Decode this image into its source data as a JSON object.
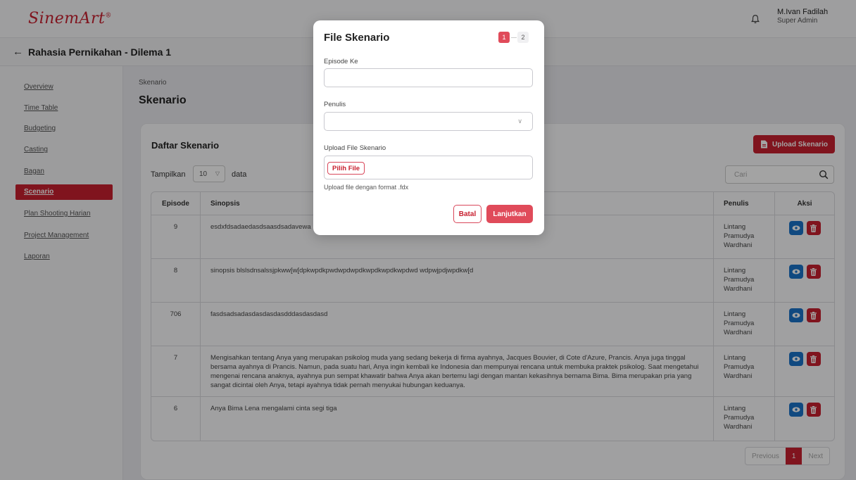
{
  "header": {
    "logo_text": "SinemArt",
    "logo_mark": "®",
    "user_name": "M.Ivan Fadilah",
    "user_role": "Super Admin"
  },
  "project": {
    "back_glyph": "←",
    "title": "Rahasia Pernikahan - Dilema 1"
  },
  "sidebar": {
    "items": [
      {
        "label": "Overview"
      },
      {
        "label": "Time Table"
      },
      {
        "label": "Budgeting"
      },
      {
        "label": "Casting"
      },
      {
        "label": "Bagan"
      },
      {
        "label": "Scenario"
      },
      {
        "label": "Plan Shooting Harian"
      },
      {
        "label": "Project Management"
      },
      {
        "label": "Laporan"
      }
    ]
  },
  "main": {
    "breadcrumb": "Skenario",
    "page_title": "Skenario",
    "card_title": "Daftar Skenario",
    "upload_label": "Upload Skenario",
    "show_label": "Tampilkan",
    "show_value": "10",
    "data_label": "data",
    "search_placeholder": "Cari",
    "columns": [
      "Episode",
      "Sinopsis",
      "Penulis",
      "Aksi"
    ],
    "rows": [
      {
        "episode": "9",
        "sinopsis": "esdxfdsadaedasdsaasdsadavewa",
        "penulis": "Lintang Pramudya Wardhani"
      },
      {
        "episode": "8",
        "sinopsis": "sinopsis blslsdnsalssjpkww[w[dpkwpdkpwdwpdwpdkwpdkwpdkwpdwd wdpwjpdjwpdkw[d",
        "penulis": "Lintang Pramudya Wardhani"
      },
      {
        "episode": "706",
        "sinopsis": "fasdsadsadasdasdasdasdddasdasdasd",
        "penulis": "Lintang Pramudya Wardhani"
      },
      {
        "episode": "7",
        "sinopsis": "Mengisahkan tentang Anya yang merupakan psikolog muda yang sedang bekerja di firma ayahnya, Jacques Bouvier, di Cote d'Azure, Prancis. Anya juga tinggal bersama ayahnya di Prancis. Namun, pada suatu hari, Anya ingin kembali ke Indonesia dan mempunyai rencana untuk membuka praktek psikolog. Saat mengetahui mengenai rencana anaknya, ayahnya pun sempat khawatir bahwa Anya akan bertemu lagi dengan mantan kekasihnya bernama Bima. Bima merupakan pria yang sangat dicintai oleh Anya, tetapi ayahnya tidak pernah menyukai hubungan keduanya.",
        "penulis": "Lintang Pramudya Wardhani"
      },
      {
        "episode": "6",
        "sinopsis": "Anya Bima Lena mengalami cinta segi tiga",
        "penulis": "Lintang Pramudya Wardhani"
      }
    ],
    "pagination": {
      "previous": "Previous",
      "current": "1",
      "next": "Next"
    }
  },
  "modal": {
    "title": "File Skenario",
    "step1": "1",
    "step2": "2",
    "episode_label": "Episode Ke",
    "episode_value": "",
    "writer_label": "Penulis",
    "writer_value": "",
    "upload_label": "Upload File Skenario",
    "pick_file": "Pilih File",
    "hint": "Upload file dengan format .fdx",
    "cancel": "Batal",
    "continue": "Lanjutkan"
  },
  "colors": {
    "brand_red": "#c8202f",
    "view_blue": "#1a73c8"
  }
}
